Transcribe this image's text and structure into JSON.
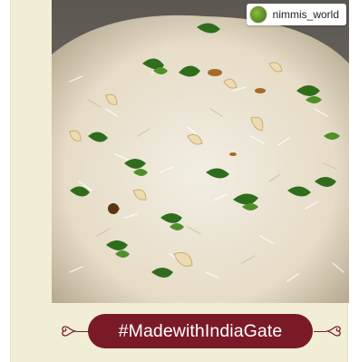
{
  "post": {
    "handle": "nimmis_world",
    "hashtag": "#MadewithIndiaGate"
  },
  "icons": {
    "avatar": "profile-avatar",
    "ornaments": "swirl-ornament"
  },
  "colors": {
    "frame": "#f2eed6",
    "hashtag_pill": "#7a1a28",
    "hashtag_text": "#ffffff"
  }
}
